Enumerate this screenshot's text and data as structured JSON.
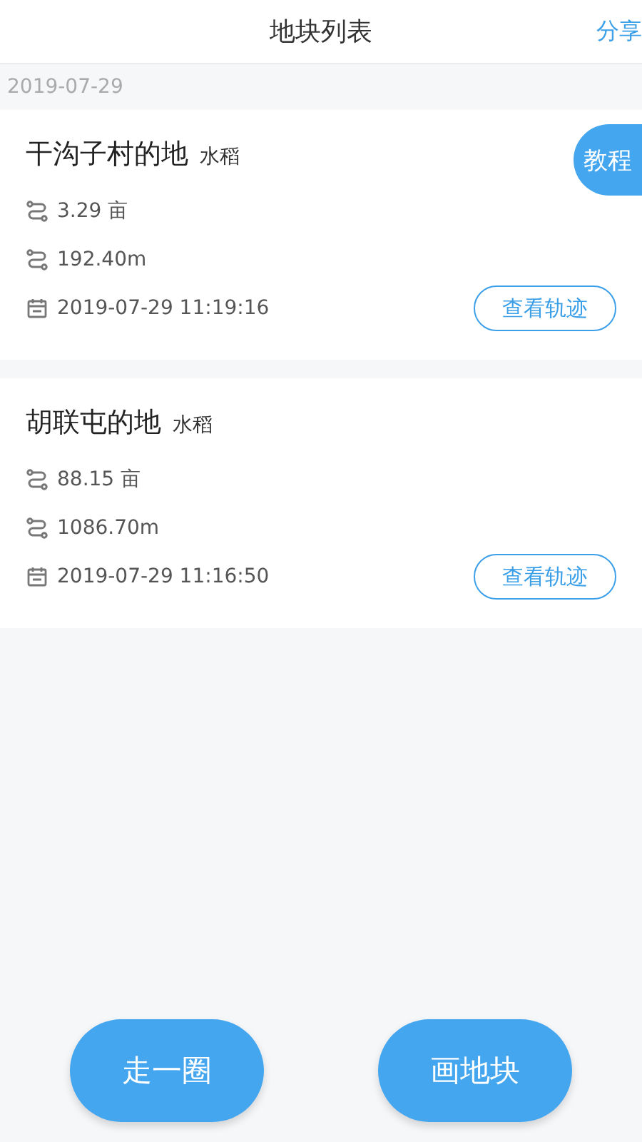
{
  "header": {
    "title": "地块列表",
    "action": "分享"
  },
  "date_group": "2019-07-29",
  "tutorial_button": "教程",
  "plots": [
    {
      "name": "干沟子村的地",
      "crop": "水稻",
      "area": "3.29 亩",
      "length": "192.40m",
      "time": "2019-07-29 11:19:16",
      "button": "查看轨迹"
    },
    {
      "name": "胡联屯的地",
      "crop": "水稻",
      "area": "88.15 亩",
      "length": "1086.70m",
      "time": "2019-07-29 11:16:50",
      "button": "查看轨迹"
    }
  ],
  "bottom_buttons": [
    "走一圈",
    "画地块"
  ]
}
